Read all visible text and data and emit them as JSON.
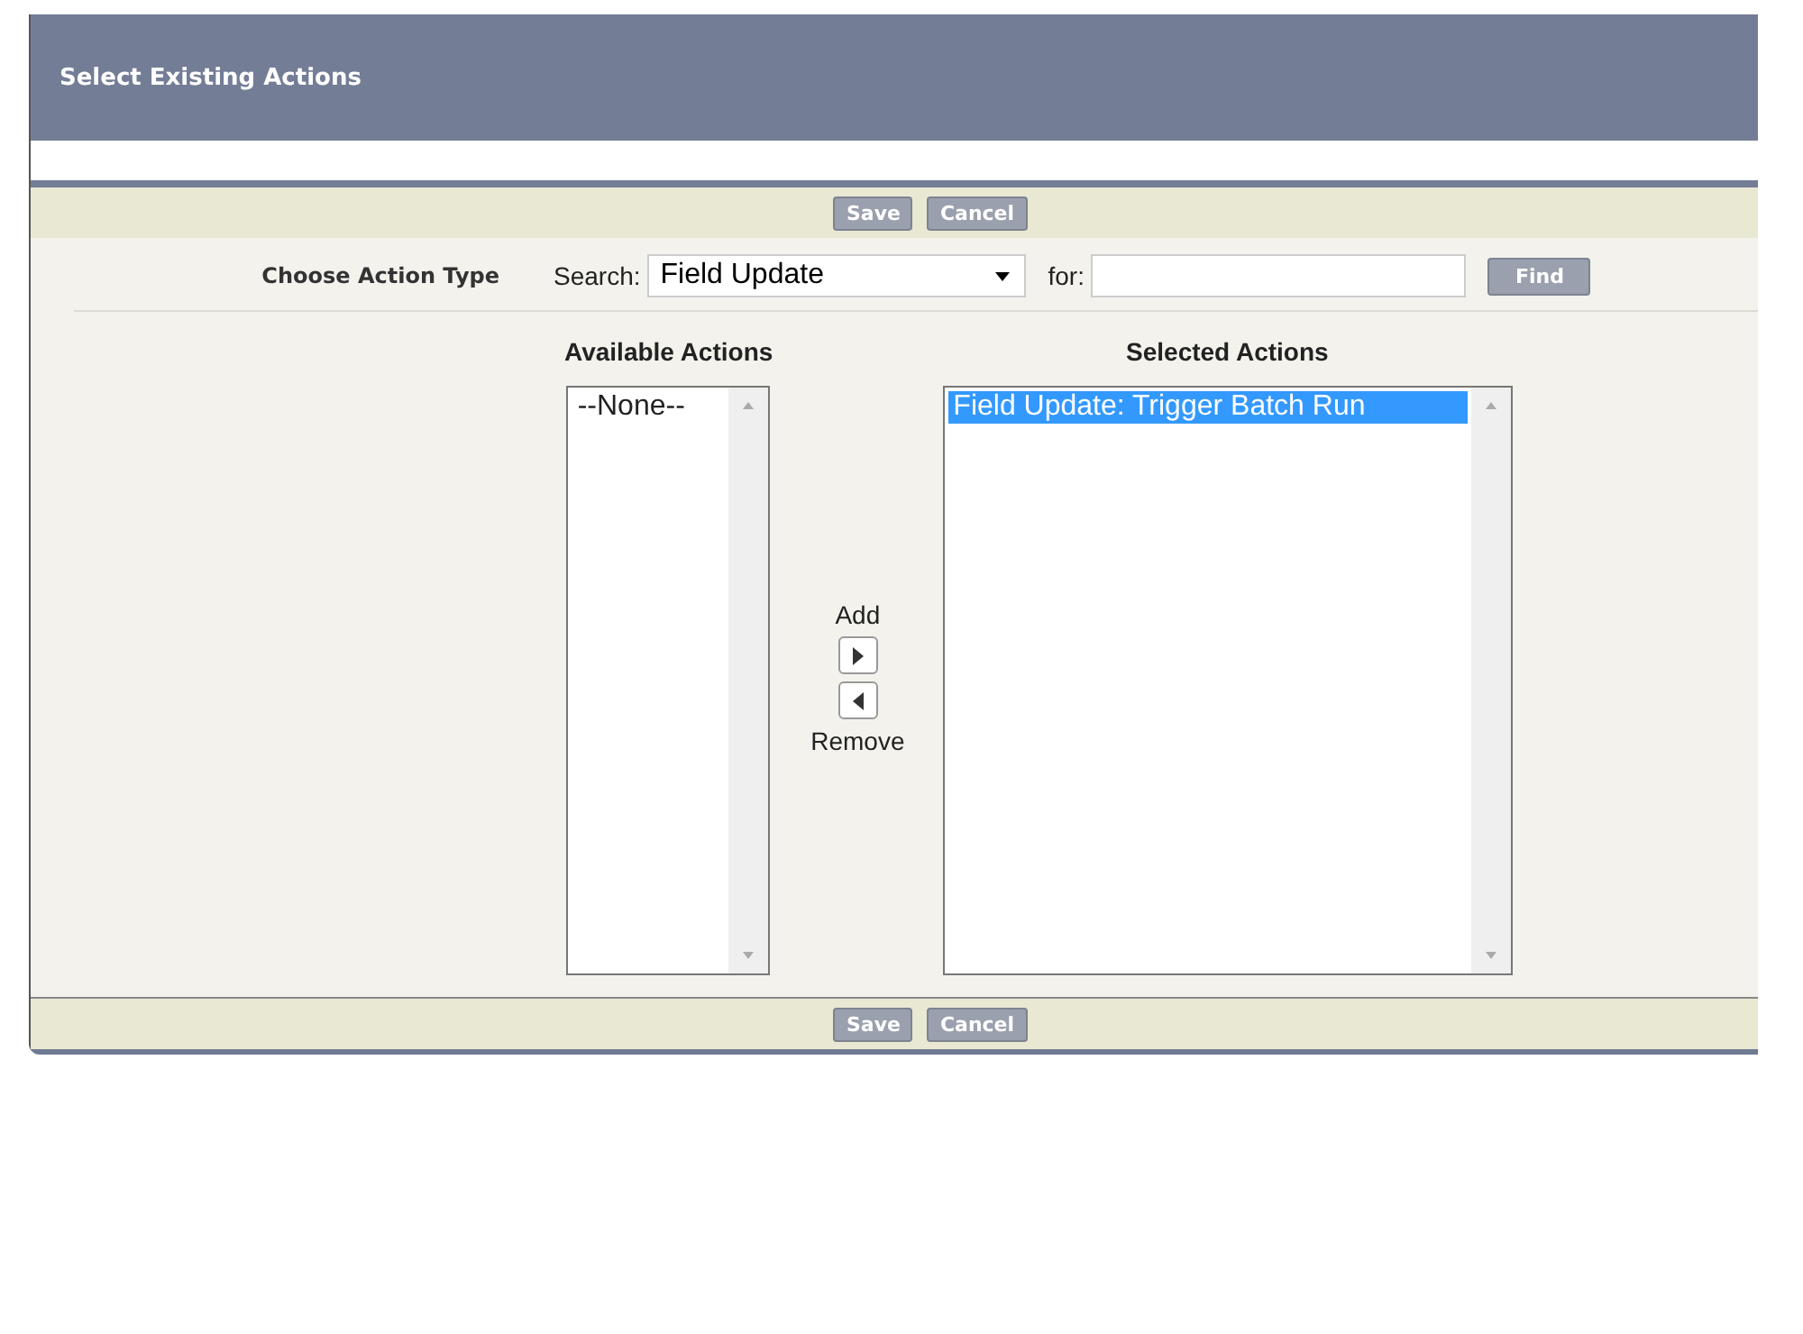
{
  "window": {
    "title": "Select Existing Actions"
  },
  "top_buttons": [
    "Save",
    "Cancel"
  ],
  "action_type": {
    "label": "Choose Action Type",
    "search_label": "Search:",
    "search_value": "Field Update",
    "for_label": "for:",
    "find_button": "Find"
  },
  "available": {
    "heading": "Available Actions",
    "items": [
      {
        "text": "--None--",
        "selected": false
      }
    ]
  },
  "mover": {
    "add_label": "Add",
    "remove_label": "Remove"
  },
  "selected": {
    "heading": "Selected Actions",
    "items": [
      {
        "text": "Field Update: Trigger Batch Run",
        "selected": true
      }
    ]
  },
  "bottom_buttons": [
    "Save",
    "Cancel"
  ]
}
